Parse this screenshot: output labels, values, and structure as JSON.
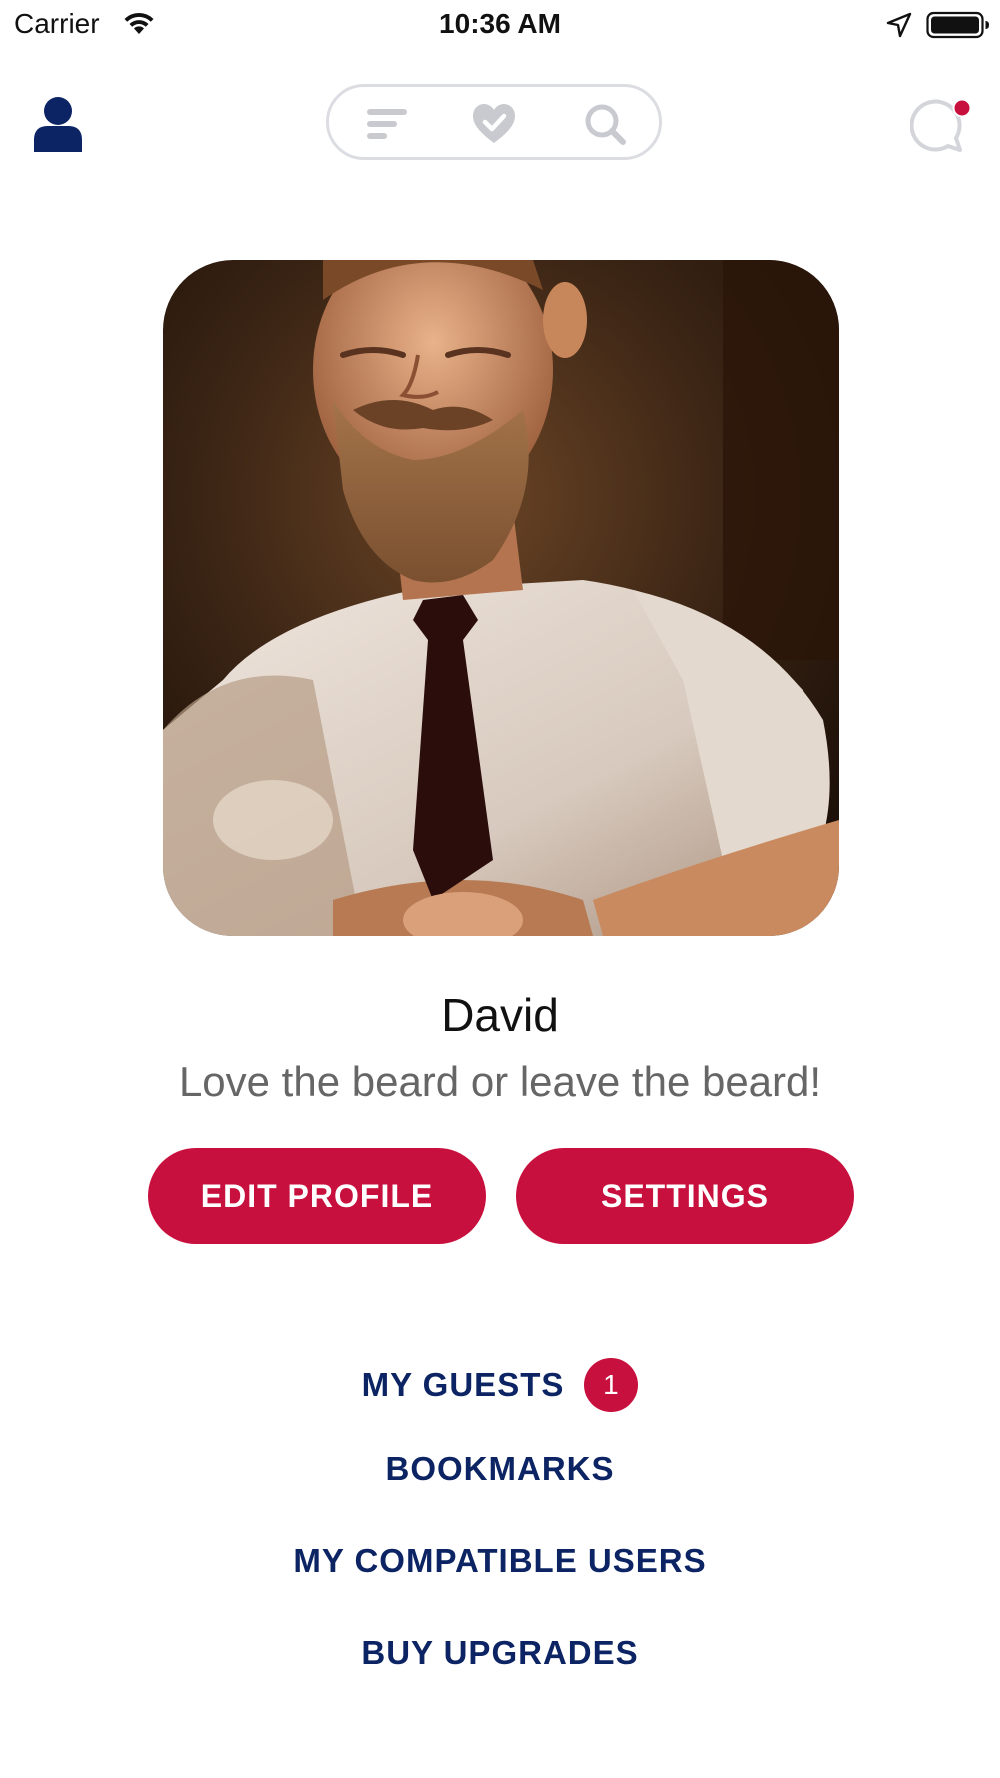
{
  "status_bar": {
    "carrier": "Carrier",
    "time": "10:36 AM",
    "icons": [
      "wifi-icon",
      "location-arrow-icon",
      "battery-icon"
    ]
  },
  "top_nav": {
    "left_icon": "profile-person-icon",
    "center_pill_icons": [
      "menu-lines-icon",
      "heart-check-icon",
      "search-icon"
    ],
    "right_icon": "chat-bubble-icon",
    "chat_has_notification": true
  },
  "profile": {
    "photo": "profile-photo",
    "name": "David",
    "tagline": "Love the beard or leave the beard!"
  },
  "actions": {
    "edit_profile": "EDIT PROFILE",
    "settings": "SETTINGS"
  },
  "menu": {
    "guests": "MY GUESTS",
    "guests_count": "1",
    "bookmarks": "BOOKMARKS",
    "compatible_users": "MY COMPATIBLE USERS",
    "buy_upgrades": "BUY UPGRADES"
  },
  "colors": {
    "accent": "#c8103e",
    "navy": "#0c2463",
    "nav_icon_gray": "#c9cad0",
    "pill_border": "#dcdde2"
  }
}
